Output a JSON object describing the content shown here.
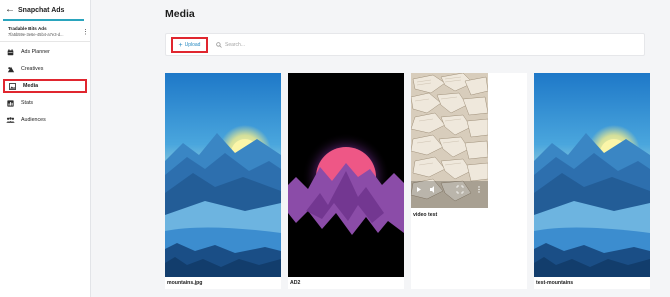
{
  "sidebar": {
    "app_title": "Snapchat Ads",
    "account_name": "Tradable Bits Ads",
    "account_id": "7fa5b59e-3e6e-45b4-a7e3-d...",
    "nav": [
      {
        "label": "Ads Planner",
        "icon": "ads-planner-icon"
      },
      {
        "label": "Creatives",
        "icon": "creatives-icon"
      },
      {
        "label": "Media",
        "icon": "media-icon",
        "active": true
      },
      {
        "label": "Stats",
        "icon": "stats-icon"
      },
      {
        "label": "Audiences",
        "icon": "audiences-icon"
      }
    ]
  },
  "main": {
    "title": "Media",
    "upload_label": "Upload",
    "search_placeholder": "Search..."
  },
  "media": [
    {
      "label": "mountains.jpg",
      "type": "image"
    },
    {
      "label": "AD2",
      "type": "image"
    },
    {
      "label": "video test",
      "type": "video"
    },
    {
      "label": "test-mountains",
      "type": "image"
    }
  ],
  "colors": {
    "accent": "#2aa4bd",
    "highlight": "#e0262f",
    "link": "#2a8bc2"
  }
}
